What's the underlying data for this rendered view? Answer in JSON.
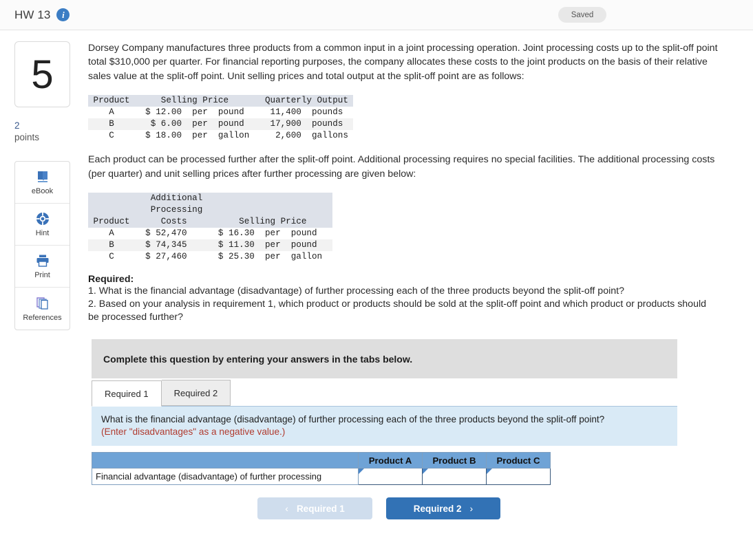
{
  "header": {
    "title": "HW 13",
    "info_icon": "info-icon",
    "saved_label": "Saved"
  },
  "rail": {
    "question_number": "5",
    "points_value": "2",
    "points_label": "points",
    "tools": [
      {
        "label": "eBook",
        "icon": "book-icon"
      },
      {
        "label": "Hint",
        "icon": "lifebuoy-icon"
      },
      {
        "label": "Print",
        "icon": "printer-icon"
      },
      {
        "label": "References",
        "icon": "pages-stack-icon"
      }
    ]
  },
  "question": {
    "paragraph1": "Dorsey Company manufactures three products from a common input in a joint processing operation. Joint processing costs up to the split-off point total $310,000 per quarter. For financial reporting purposes, the company allocates these costs to the joint products on the basis of their relative sales value at the split-off point. Unit selling prices and total output at the split-off point are as follows:",
    "paragraph2": "Each product can be processed further after the split-off point. Additional processing requires no special facilities. The additional processing costs (per quarter) and unit selling prices after further processing are given below:",
    "required_heading": "Required:",
    "required_1": "1. What is the financial advantage (disadvantage) of further processing each of the three products beyond the split-off point?",
    "required_2": "2. Based on your analysis in requirement 1, which product or products should be sold at the split-off point and which product or products should be processed further?"
  },
  "table1": {
    "headers": [
      "Product",
      "Selling Price",
      "Quarterly Output"
    ],
    "rows": [
      {
        "product": "A",
        "selling_price": "$ 12.00 per pound",
        "output": "11,400 pounds"
      },
      {
        "product": "B",
        "selling_price": "$  6.00 per pound",
        "output": "17,900 pounds"
      },
      {
        "product": "C",
        "selling_price": "$ 18.00 per gallon",
        "output": " 2,600 gallons"
      }
    ],
    "raw_lines": [
      " Product      Selling Price       Quarterly Output ",
      "    A      $ 12.00  per  pound     11,400  pounds  ",
      "    B       $ 6.00  per  pound     17,900  pounds  ",
      "    C      $ 18.00  per  gallon     2,600  gallons "
    ]
  },
  "table2": {
    "header_line1": "            Additional                       ",
    "header_line2": "            Processing                       ",
    "header_line3": " Product      Costs          Selling Price  ",
    "raw_lines": [
      "    A      $ 52,470      $ 16.30  per  pound   ",
      "    B      $ 74,345      $ 11.30  per  pound   ",
      "    C      $ 27,460      $ 25.30  per  gallon  "
    ],
    "headers": [
      "Product",
      "Additional Processing Costs",
      "Selling Price"
    ],
    "rows": [
      {
        "product": "A",
        "additional_processing_costs": "$ 52,470",
        "selling_price": "$ 16.30 per pound"
      },
      {
        "product": "B",
        "additional_processing_costs": "$ 74,345",
        "selling_price": "$ 11.30 per pound"
      },
      {
        "product": "C",
        "additional_processing_costs": "$ 27,460",
        "selling_price": "$ 25.30 per gallon"
      }
    ]
  },
  "instruction_banner": "Complete this question by entering your answers in the tabs below.",
  "tabs": [
    {
      "label": "Required 1",
      "active": true
    },
    {
      "label": "Required 2",
      "active": false
    }
  ],
  "prompt": {
    "line1": "What is the financial advantage (disadvantage) of further processing each of the three products beyond the split-off point?",
    "line2": "(Enter \"disadvantages\" as a negative value.)"
  },
  "answer_table": {
    "corner_header": "",
    "column_headers": [
      "Product A",
      "Product B",
      "Product C"
    ],
    "row_label": "Financial advantage (disadvantage) of further processing",
    "values": [
      "",
      "",
      ""
    ]
  },
  "nav": {
    "prev_label": "Required 1",
    "next_label": "Required 2",
    "prev_chevron": "‹",
    "next_chevron": "›"
  },
  "colors": {
    "accent_blue": "#3272b5",
    "table_header_blue": "#6fa3d6",
    "prompt_blue": "#d9eaf6",
    "warn_red": "#b03a2e",
    "banner_gray": "#dedede"
  }
}
